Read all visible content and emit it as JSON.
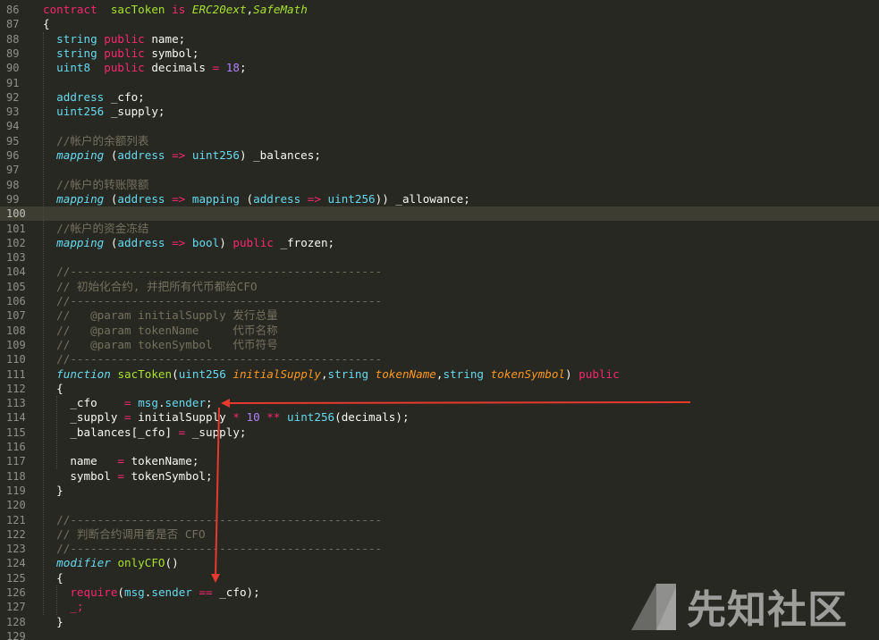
{
  "editor": {
    "current_line": 100,
    "watermark_text": "先知社区",
    "arrow_color": "#e8392f",
    "lines": [
      {
        "n": "86",
        "tokens": [
          [
            "k",
            "contract"
          ],
          [
            "",
            "  "
          ],
          [
            "f",
            "sacToken"
          ],
          [
            "",
            " "
          ],
          [
            "k",
            "is"
          ],
          [
            "",
            " "
          ],
          [
            "ih",
            "ERC20ext"
          ],
          [
            "",
            ","
          ],
          [
            "ih",
            "SafeMath"
          ]
        ]
      },
      {
        "n": "87",
        "tokens": [
          [
            "",
            "{"
          ]
        ]
      },
      {
        "n": "88",
        "tokens": [
          [
            "",
            "  "
          ],
          [
            "t",
            "string"
          ],
          [
            "",
            " "
          ],
          [
            "k",
            "public"
          ],
          [
            "",
            " name;"
          ]
        ]
      },
      {
        "n": "89",
        "tokens": [
          [
            "",
            "  "
          ],
          [
            "t",
            "string"
          ],
          [
            "",
            " "
          ],
          [
            "k",
            "public"
          ],
          [
            "",
            " symbol;"
          ]
        ]
      },
      {
        "n": "90",
        "tokens": [
          [
            "",
            "  "
          ],
          [
            "t",
            "uint8"
          ],
          [
            "",
            "  "
          ],
          [
            "k",
            "public"
          ],
          [
            "",
            " decimals "
          ],
          [
            "k",
            "="
          ],
          [
            "",
            " "
          ],
          [
            "n",
            "18"
          ],
          [
            "",
            ";"
          ]
        ]
      },
      {
        "n": "91",
        "tokens": []
      },
      {
        "n": "92",
        "tokens": [
          [
            "",
            "  "
          ],
          [
            "t",
            "address"
          ],
          [
            "",
            " _cfo;"
          ]
        ]
      },
      {
        "n": "93",
        "tokens": [
          [
            "",
            "  "
          ],
          [
            "t",
            "uint256"
          ],
          [
            "",
            " _supply;"
          ]
        ]
      },
      {
        "n": "94",
        "tokens": []
      },
      {
        "n": "95",
        "tokens": [
          [
            "",
            "  "
          ],
          [
            "c",
            "//帐户的余额列表"
          ]
        ]
      },
      {
        "n": "96",
        "tokens": [
          [
            "",
            "  "
          ],
          [
            "ti",
            "mapping"
          ],
          [
            "",
            " ("
          ],
          [
            "t",
            "address"
          ],
          [
            "",
            " "
          ],
          [
            "k",
            "=>"
          ],
          [
            "",
            " "
          ],
          [
            "t",
            "uint256"
          ],
          [
            "",
            ") _balances;"
          ]
        ]
      },
      {
        "n": "97",
        "tokens": []
      },
      {
        "n": "98",
        "tokens": [
          [
            "",
            "  "
          ],
          [
            "c",
            "//帐户的转账限额"
          ]
        ]
      },
      {
        "n": "99",
        "tokens": [
          [
            "",
            "  "
          ],
          [
            "ti",
            "mapping"
          ],
          [
            "",
            " ("
          ],
          [
            "t",
            "address"
          ],
          [
            "",
            " "
          ],
          [
            "k",
            "=>"
          ],
          [
            "",
            " "
          ],
          [
            "t",
            "mapping"
          ],
          [
            "",
            " ("
          ],
          [
            "t",
            "address"
          ],
          [
            "",
            " "
          ],
          [
            "k",
            "=>"
          ],
          [
            "",
            " "
          ],
          [
            "t",
            "uint256"
          ],
          [
            "",
            "))"
          ],
          [
            "",
            " _allowance;"
          ]
        ]
      },
      {
        "n": "100",
        "tokens": []
      },
      {
        "n": "101",
        "tokens": [
          [
            "",
            "  "
          ],
          [
            "c",
            "//帐户的资金冻结"
          ]
        ]
      },
      {
        "n": "102",
        "tokens": [
          [
            "",
            "  "
          ],
          [
            "ti",
            "mapping"
          ],
          [
            "",
            " ("
          ],
          [
            "t",
            "address"
          ],
          [
            "",
            " "
          ],
          [
            "k",
            "=>"
          ],
          [
            "",
            " "
          ],
          [
            "t",
            "bool"
          ],
          [
            "",
            ") "
          ],
          [
            "k",
            "public"
          ],
          [
            "",
            " _frozen;"
          ]
        ]
      },
      {
        "n": "103",
        "tokens": []
      },
      {
        "n": "104",
        "tokens": [
          [
            "",
            "  "
          ],
          [
            "c",
            "//----------------------------------------------"
          ]
        ]
      },
      {
        "n": "105",
        "tokens": [
          [
            "",
            "  "
          ],
          [
            "c",
            "// 初始化合约, 并把所有代币都给CFO"
          ]
        ]
      },
      {
        "n": "106",
        "tokens": [
          [
            "",
            "  "
          ],
          [
            "c",
            "//----------------------------------------------"
          ]
        ]
      },
      {
        "n": "107",
        "tokens": [
          [
            "",
            "  "
          ],
          [
            "c",
            "//   @param initialSupply 发行总量"
          ]
        ]
      },
      {
        "n": "108",
        "tokens": [
          [
            "",
            "  "
          ],
          [
            "c",
            "//   @param tokenName     代币名称"
          ]
        ]
      },
      {
        "n": "109",
        "tokens": [
          [
            "",
            "  "
          ],
          [
            "c",
            "//   @param tokenSymbol   代币符号"
          ]
        ]
      },
      {
        "n": "110",
        "tokens": [
          [
            "",
            "  "
          ],
          [
            "c",
            "//----------------------------------------------"
          ]
        ]
      },
      {
        "n": "111",
        "tokens": [
          [
            "",
            "  "
          ],
          [
            "ti",
            "function"
          ],
          [
            "",
            " "
          ],
          [
            "f",
            "sacToken"
          ],
          [
            "",
            "("
          ],
          [
            "t",
            "uint256"
          ],
          [
            "",
            " "
          ],
          [
            "p",
            "initialSupply"
          ],
          [
            "",
            ","
          ],
          [
            "t",
            "string"
          ],
          [
            "",
            " "
          ],
          [
            "p",
            "tokenName"
          ],
          [
            "",
            ","
          ],
          [
            "t",
            "string"
          ],
          [
            "",
            " "
          ],
          [
            "p",
            "tokenSymbol"
          ],
          [
            "",
            ") "
          ],
          [
            "k",
            "public"
          ]
        ]
      },
      {
        "n": "112",
        "tokens": [
          [
            "",
            "  {"
          ]
        ]
      },
      {
        "n": "113",
        "tokens": [
          [
            "",
            "    _cfo    "
          ],
          [
            "k",
            "="
          ],
          [
            "",
            " "
          ],
          [
            "t",
            "msg"
          ],
          [
            "",
            "."
          ],
          [
            "t",
            "sender"
          ],
          [
            "",
            ";"
          ]
        ]
      },
      {
        "n": "114",
        "tokens": [
          [
            "",
            "    _supply "
          ],
          [
            "k",
            "="
          ],
          [
            "",
            " initialSupply "
          ],
          [
            "k",
            "*"
          ],
          [
            "",
            " "
          ],
          [
            "n",
            "10"
          ],
          [
            "",
            " "
          ],
          [
            "k",
            "**"
          ],
          [
            "",
            " "
          ],
          [
            "t",
            "uint256"
          ],
          [
            "",
            "(decimals);"
          ]
        ]
      },
      {
        "n": "115",
        "tokens": [
          [
            "",
            "    _balances[_cfo] "
          ],
          [
            "k",
            "="
          ],
          [
            "",
            " _supply;"
          ]
        ]
      },
      {
        "n": "116",
        "tokens": []
      },
      {
        "n": "117",
        "tokens": [
          [
            "",
            "    name   "
          ],
          [
            "k",
            "="
          ],
          [
            "",
            " tokenName;"
          ]
        ]
      },
      {
        "n": "118",
        "tokens": [
          [
            "",
            "    symbol "
          ],
          [
            "k",
            "="
          ],
          [
            "",
            " tokenSymbol;"
          ]
        ]
      },
      {
        "n": "119",
        "tokens": [
          [
            "",
            "  }"
          ]
        ]
      },
      {
        "n": "120",
        "tokens": []
      },
      {
        "n": "121",
        "tokens": [
          [
            "",
            "  "
          ],
          [
            "c",
            "//----------------------------------------------"
          ]
        ]
      },
      {
        "n": "122",
        "tokens": [
          [
            "",
            "  "
          ],
          [
            "c",
            "// 判断合约调用者是否 CFO"
          ]
        ]
      },
      {
        "n": "123",
        "tokens": [
          [
            "",
            "  "
          ],
          [
            "c",
            "//----------------------------------------------"
          ]
        ]
      },
      {
        "n": "124",
        "tokens": [
          [
            "",
            "  "
          ],
          [
            "ti",
            "modifier"
          ],
          [
            "",
            " "
          ],
          [
            "f",
            "onlyCFO"
          ],
          [
            "",
            "()"
          ]
        ]
      },
      {
        "n": "125",
        "tokens": [
          [
            "",
            "  {"
          ]
        ]
      },
      {
        "n": "126",
        "tokens": [
          [
            "",
            "    "
          ],
          [
            "k",
            "require"
          ],
          [
            "",
            "("
          ],
          [
            "t",
            "msg"
          ],
          [
            "",
            "."
          ],
          [
            "t",
            "sender"
          ],
          [
            "",
            " "
          ],
          [
            "k",
            "=="
          ],
          [
            "",
            " _cfo);"
          ]
        ]
      },
      {
        "n": "127",
        "tokens": [
          [
            "",
            "    "
          ],
          [
            "k",
            "_;"
          ]
        ]
      },
      {
        "n": "128",
        "tokens": [
          [
            "",
            "  }"
          ]
        ]
      },
      {
        "n": "129",
        "tokens": []
      }
    ]
  }
}
